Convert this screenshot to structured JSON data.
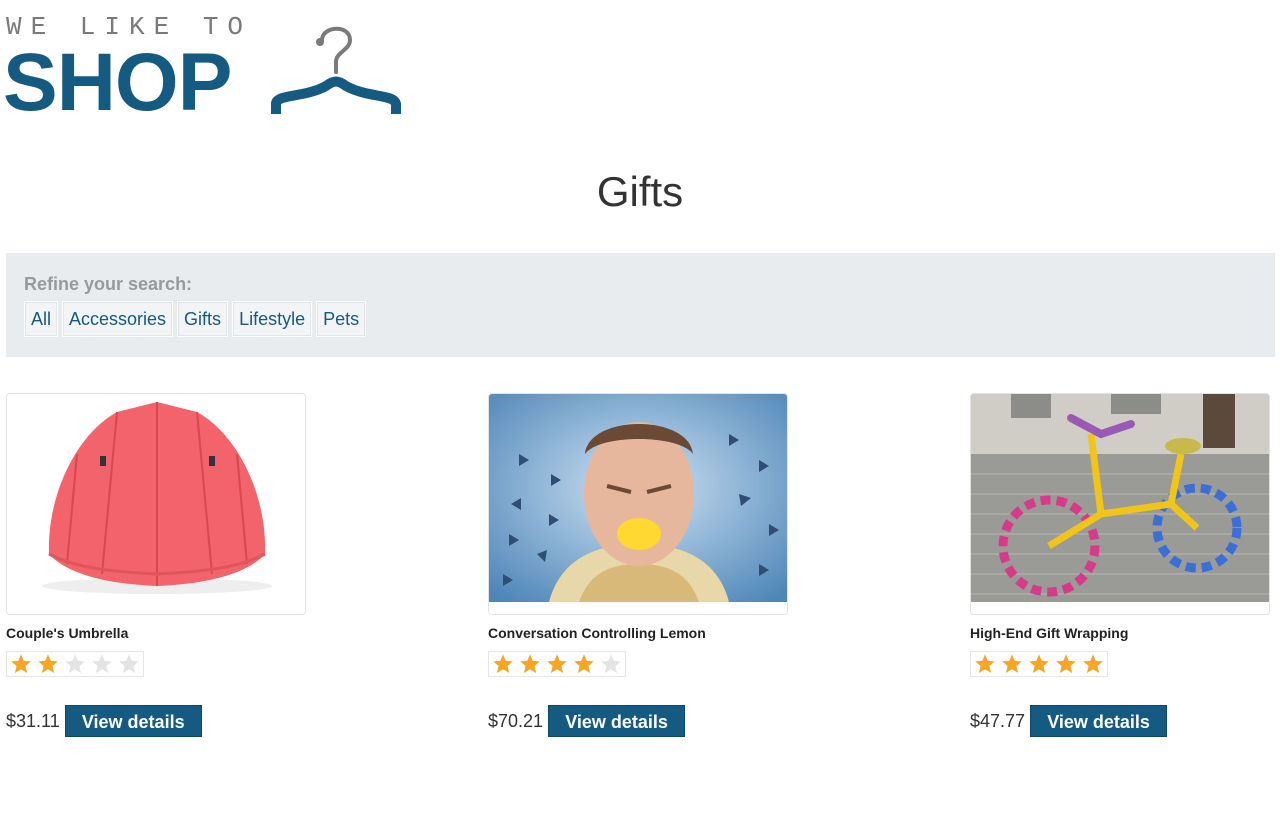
{
  "logo": {
    "tagline": "WE LIKE TO",
    "wordmark": "SHOP",
    "icon": "hanger-icon"
  },
  "page": {
    "title": "Gifts"
  },
  "filters": {
    "label": "Refine your search:",
    "items": [
      "All",
      "Accessories",
      "Gifts",
      "Lifestyle",
      "Pets"
    ]
  },
  "products": [
    {
      "name": "Couple's Umbrella",
      "rating": 2,
      "max_rating": 5,
      "price": "$31.11",
      "button": "View details"
    },
    {
      "name": "Conversation Controlling Lemon",
      "rating": 4,
      "max_rating": 5,
      "price": "$70.21",
      "button": "View details"
    },
    {
      "name": "High-End Gift Wrapping",
      "rating": 5,
      "max_rating": 5,
      "price": "$47.77",
      "button": "View details"
    }
  ],
  "colors": {
    "brand": "#155a80",
    "star_on": "#f5a623",
    "star_off": "#e4e4e4",
    "panel": "#e9ecef"
  }
}
